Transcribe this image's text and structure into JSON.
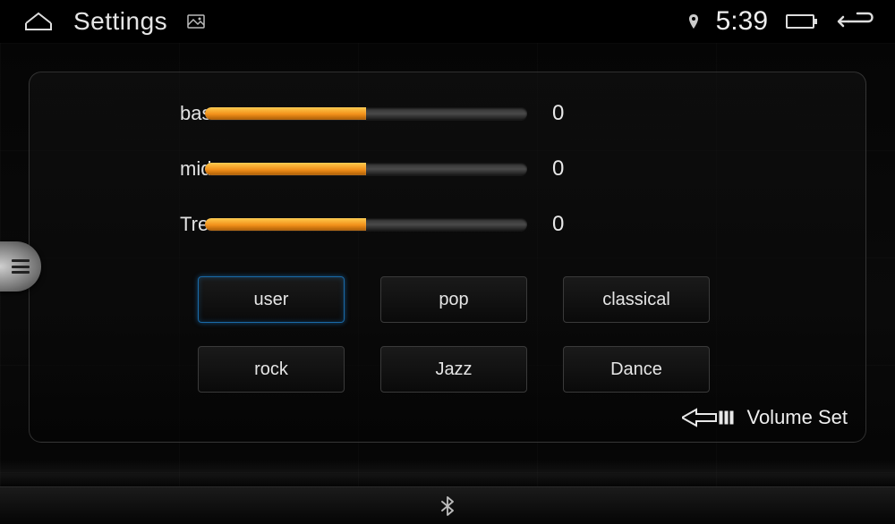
{
  "statusbar": {
    "title": "Settings",
    "clock": "5:39"
  },
  "eq": {
    "sliders": [
      {
        "label": "bass",
        "value": 0,
        "percent": 50
      },
      {
        "label": "mid",
        "value": 0,
        "percent": 50
      },
      {
        "label": "Tre",
        "value": 0,
        "percent": 50
      }
    ],
    "presets": [
      {
        "label": "user",
        "active": true
      },
      {
        "label": "pop",
        "active": false
      },
      {
        "label": "classical",
        "active": false
      },
      {
        "label": "rock",
        "active": false
      },
      {
        "label": "Jazz",
        "active": false
      },
      {
        "label": "Dance",
        "active": false
      }
    ],
    "volume_set_label": "Volume Set"
  }
}
